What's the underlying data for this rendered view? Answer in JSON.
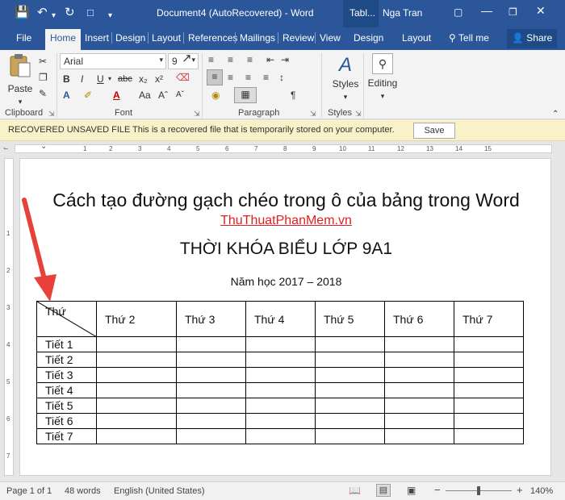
{
  "title_bar": {
    "document_title": "Document4 (AutoRecovered)  -  Word",
    "context_tab": "Tabl...",
    "user": "Nga Tran",
    "quick_access": [
      "save-icon",
      "undo-icon",
      "redo-icon",
      "touch-mode-icon",
      "customize-icon"
    ],
    "window_controls": [
      "ribbon-options-icon",
      "minimize-icon",
      "restore-icon",
      "close-icon"
    ]
  },
  "tabs": [
    "File",
    "Home",
    "Insert",
    "Design",
    "Layout",
    "References",
    "Mailings",
    "Review",
    "View",
    "Design",
    "Layout"
  ],
  "active_tab": "Home",
  "tell_me": "Tell me",
  "share": "Share",
  "ribbon": {
    "clipboard": {
      "paste_label": "Paste",
      "group_label": "Clipboard"
    },
    "font": {
      "font_name": "Arial",
      "font_size": "9",
      "buttons": [
        "B",
        "I",
        "U",
        "abc",
        "x₂",
        "x²"
      ],
      "group_label": "Font"
    },
    "paragraph": {
      "group_label": "Paragraph"
    },
    "styles": {
      "label": "Styles",
      "group_label": "Styles"
    },
    "editing": {
      "label": "Editing"
    }
  },
  "info_bar": {
    "title": "RECOVERED UNSAVED FILE",
    "message": "This is a recovered file that is temporarily stored on your computer.",
    "button": "Save"
  },
  "ruler": {
    "h_numbers": [
      "1",
      "2",
      "3",
      "4",
      "5",
      "6",
      "7",
      "8",
      "9",
      "10",
      "11",
      "12",
      "13",
      "14",
      "15"
    ],
    "v_numbers": [
      "1",
      "2",
      "3",
      "4",
      "5",
      "6",
      "7"
    ]
  },
  "document": {
    "heading": "Cách tạo đường gạch chéo trong ô của bảng trong Word",
    "site": "ThuThuatPhanMem.vn",
    "subheading": "THỜI KHÓA BIỂU LỚP 9A1",
    "year": "Năm học 2017 – 2018",
    "table": {
      "corner": "Thứ",
      "columns": [
        "Thứ 2",
        "Thứ 3",
        "Thứ 4",
        "Thứ 5",
        "Thứ 6",
        "Thứ 7"
      ],
      "rows": [
        "Tiết 1",
        "Tiết 2",
        "Tiết 3",
        "Tiết 4",
        "Tiết 5",
        "Tiết 6",
        "Tiết 7"
      ]
    }
  },
  "status_bar": {
    "page": "Page 1 of 1",
    "words": "48 words",
    "language": "English (United States)",
    "zoom": "140%",
    "zoom_minus": "−",
    "zoom_plus": "+"
  },
  "colors": {
    "word_blue": "#2b579a",
    "site_red": "#e02020",
    "arrow_red": "#e8413a",
    "info_bar": "#f9f1c8"
  }
}
